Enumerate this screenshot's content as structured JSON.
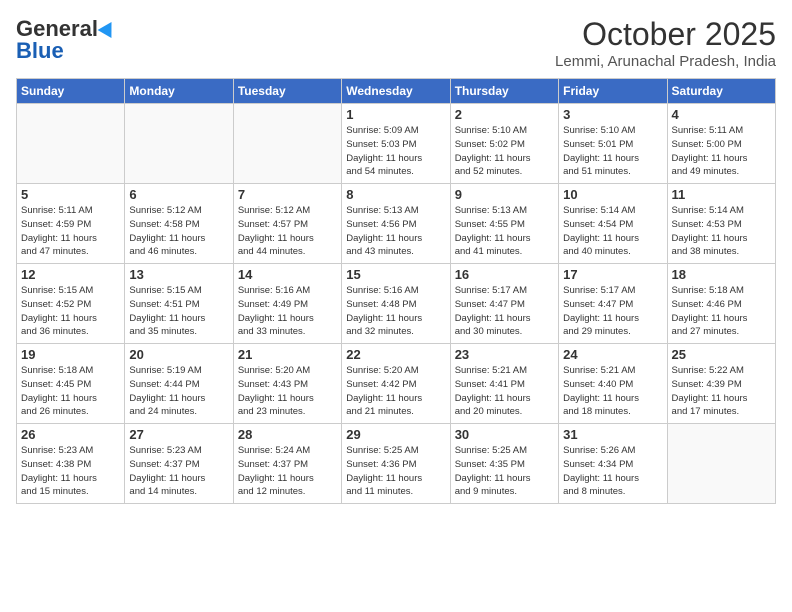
{
  "header": {
    "logo_general": "General",
    "logo_blue": "Blue",
    "title": "October 2025",
    "subtitle": "Lemmi, Arunachal Pradesh, India"
  },
  "days_of_week": [
    "Sunday",
    "Monday",
    "Tuesday",
    "Wednesday",
    "Thursday",
    "Friday",
    "Saturday"
  ],
  "cells": [
    {
      "day": "",
      "info": ""
    },
    {
      "day": "",
      "info": ""
    },
    {
      "day": "",
      "info": ""
    },
    {
      "day": "1",
      "info": "Sunrise: 5:09 AM\nSunset: 5:03 PM\nDaylight: 11 hours\nand 54 minutes."
    },
    {
      "day": "2",
      "info": "Sunrise: 5:10 AM\nSunset: 5:02 PM\nDaylight: 11 hours\nand 52 minutes."
    },
    {
      "day": "3",
      "info": "Sunrise: 5:10 AM\nSunset: 5:01 PM\nDaylight: 11 hours\nand 51 minutes."
    },
    {
      "day": "4",
      "info": "Sunrise: 5:11 AM\nSunset: 5:00 PM\nDaylight: 11 hours\nand 49 minutes."
    },
    {
      "day": "5",
      "info": "Sunrise: 5:11 AM\nSunset: 4:59 PM\nDaylight: 11 hours\nand 47 minutes."
    },
    {
      "day": "6",
      "info": "Sunrise: 5:12 AM\nSunset: 4:58 PM\nDaylight: 11 hours\nand 46 minutes."
    },
    {
      "day": "7",
      "info": "Sunrise: 5:12 AM\nSunset: 4:57 PM\nDaylight: 11 hours\nand 44 minutes."
    },
    {
      "day": "8",
      "info": "Sunrise: 5:13 AM\nSunset: 4:56 PM\nDaylight: 11 hours\nand 43 minutes."
    },
    {
      "day": "9",
      "info": "Sunrise: 5:13 AM\nSunset: 4:55 PM\nDaylight: 11 hours\nand 41 minutes."
    },
    {
      "day": "10",
      "info": "Sunrise: 5:14 AM\nSunset: 4:54 PM\nDaylight: 11 hours\nand 40 minutes."
    },
    {
      "day": "11",
      "info": "Sunrise: 5:14 AM\nSunset: 4:53 PM\nDaylight: 11 hours\nand 38 minutes."
    },
    {
      "day": "12",
      "info": "Sunrise: 5:15 AM\nSunset: 4:52 PM\nDaylight: 11 hours\nand 36 minutes."
    },
    {
      "day": "13",
      "info": "Sunrise: 5:15 AM\nSunset: 4:51 PM\nDaylight: 11 hours\nand 35 minutes."
    },
    {
      "day": "14",
      "info": "Sunrise: 5:16 AM\nSunset: 4:49 PM\nDaylight: 11 hours\nand 33 minutes."
    },
    {
      "day": "15",
      "info": "Sunrise: 5:16 AM\nSunset: 4:48 PM\nDaylight: 11 hours\nand 32 minutes."
    },
    {
      "day": "16",
      "info": "Sunrise: 5:17 AM\nSunset: 4:47 PM\nDaylight: 11 hours\nand 30 minutes."
    },
    {
      "day": "17",
      "info": "Sunrise: 5:17 AM\nSunset: 4:47 PM\nDaylight: 11 hours\nand 29 minutes."
    },
    {
      "day": "18",
      "info": "Sunrise: 5:18 AM\nSunset: 4:46 PM\nDaylight: 11 hours\nand 27 minutes."
    },
    {
      "day": "19",
      "info": "Sunrise: 5:18 AM\nSunset: 4:45 PM\nDaylight: 11 hours\nand 26 minutes."
    },
    {
      "day": "20",
      "info": "Sunrise: 5:19 AM\nSunset: 4:44 PM\nDaylight: 11 hours\nand 24 minutes."
    },
    {
      "day": "21",
      "info": "Sunrise: 5:20 AM\nSunset: 4:43 PM\nDaylight: 11 hours\nand 23 minutes."
    },
    {
      "day": "22",
      "info": "Sunrise: 5:20 AM\nSunset: 4:42 PM\nDaylight: 11 hours\nand 21 minutes."
    },
    {
      "day": "23",
      "info": "Sunrise: 5:21 AM\nSunset: 4:41 PM\nDaylight: 11 hours\nand 20 minutes."
    },
    {
      "day": "24",
      "info": "Sunrise: 5:21 AM\nSunset: 4:40 PM\nDaylight: 11 hours\nand 18 minutes."
    },
    {
      "day": "25",
      "info": "Sunrise: 5:22 AM\nSunset: 4:39 PM\nDaylight: 11 hours\nand 17 minutes."
    },
    {
      "day": "26",
      "info": "Sunrise: 5:23 AM\nSunset: 4:38 PM\nDaylight: 11 hours\nand 15 minutes."
    },
    {
      "day": "27",
      "info": "Sunrise: 5:23 AM\nSunset: 4:37 PM\nDaylight: 11 hours\nand 14 minutes."
    },
    {
      "day": "28",
      "info": "Sunrise: 5:24 AM\nSunset: 4:37 PM\nDaylight: 11 hours\nand 12 minutes."
    },
    {
      "day": "29",
      "info": "Sunrise: 5:25 AM\nSunset: 4:36 PM\nDaylight: 11 hours\nand 11 minutes."
    },
    {
      "day": "30",
      "info": "Sunrise: 5:25 AM\nSunset: 4:35 PM\nDaylight: 11 hours\nand 9 minutes."
    },
    {
      "day": "31",
      "info": "Sunrise: 5:26 AM\nSunset: 4:34 PM\nDaylight: 11 hours\nand 8 minutes."
    },
    {
      "day": "",
      "info": ""
    }
  ]
}
